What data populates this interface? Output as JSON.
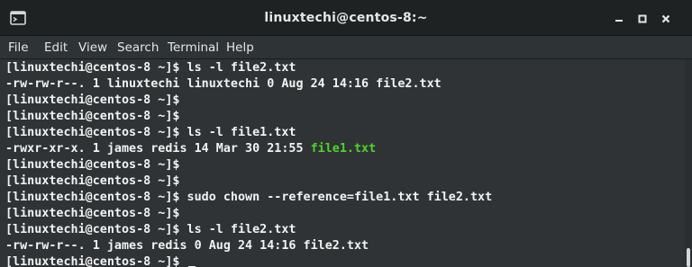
{
  "window": {
    "title": "linuxtechi@centos-8:~"
  },
  "icons": {
    "terminal": "terminal-icon",
    "minimize": "minimize-icon",
    "maximize": "maximize-icon",
    "close": "close-icon"
  },
  "menu": {
    "items": [
      "File",
      "Edit",
      "View",
      "Search",
      "Terminal",
      "Help"
    ]
  },
  "terminal": {
    "prompt": "[linuxtechi@centos-8 ~]$",
    "lines": [
      {
        "prompt": "[linuxtechi@centos-8 ~]$",
        "text": " ls -l file2.txt"
      },
      {
        "prompt": "",
        "text": "-rw-rw-r--. 1 linuxtechi linuxtechi 0 Aug 24 14:16 file2.txt"
      },
      {
        "prompt": "[linuxtechi@centos-8 ~]$",
        "text": ""
      },
      {
        "prompt": "[linuxtechi@centos-8 ~]$",
        "text": ""
      },
      {
        "prompt": "[linuxtechi@centos-8 ~]$",
        "text": " ls -l file1.txt"
      },
      {
        "prompt": "",
        "text": "-rwxr-xr-x. 1 james redis 14 Mar 30 21:55 ",
        "highlight": "file1.txt"
      },
      {
        "prompt": "[linuxtechi@centos-8 ~]$",
        "text": ""
      },
      {
        "prompt": "[linuxtechi@centos-8 ~]$",
        "text": ""
      },
      {
        "prompt": "[linuxtechi@centos-8 ~]$",
        "text": " sudo chown --reference=file1.txt file2.txt"
      },
      {
        "prompt": "[linuxtechi@centos-8 ~]$",
        "text": ""
      },
      {
        "prompt": "[linuxtechi@centos-8 ~]$",
        "text": " ls -l file2.txt"
      },
      {
        "prompt": "",
        "text": "-rw-rw-r--. 1 james redis 0 Aug 24 14:16 file2.txt"
      },
      {
        "prompt": "[linuxtechi@centos-8 ~]$",
        "text": " ",
        "cursor": true
      }
    ]
  },
  "colors": {
    "executable_filename": "#4fd32a",
    "terminal_text": "#f2f2f2",
    "terminal_bg": "#2f3335"
  }
}
